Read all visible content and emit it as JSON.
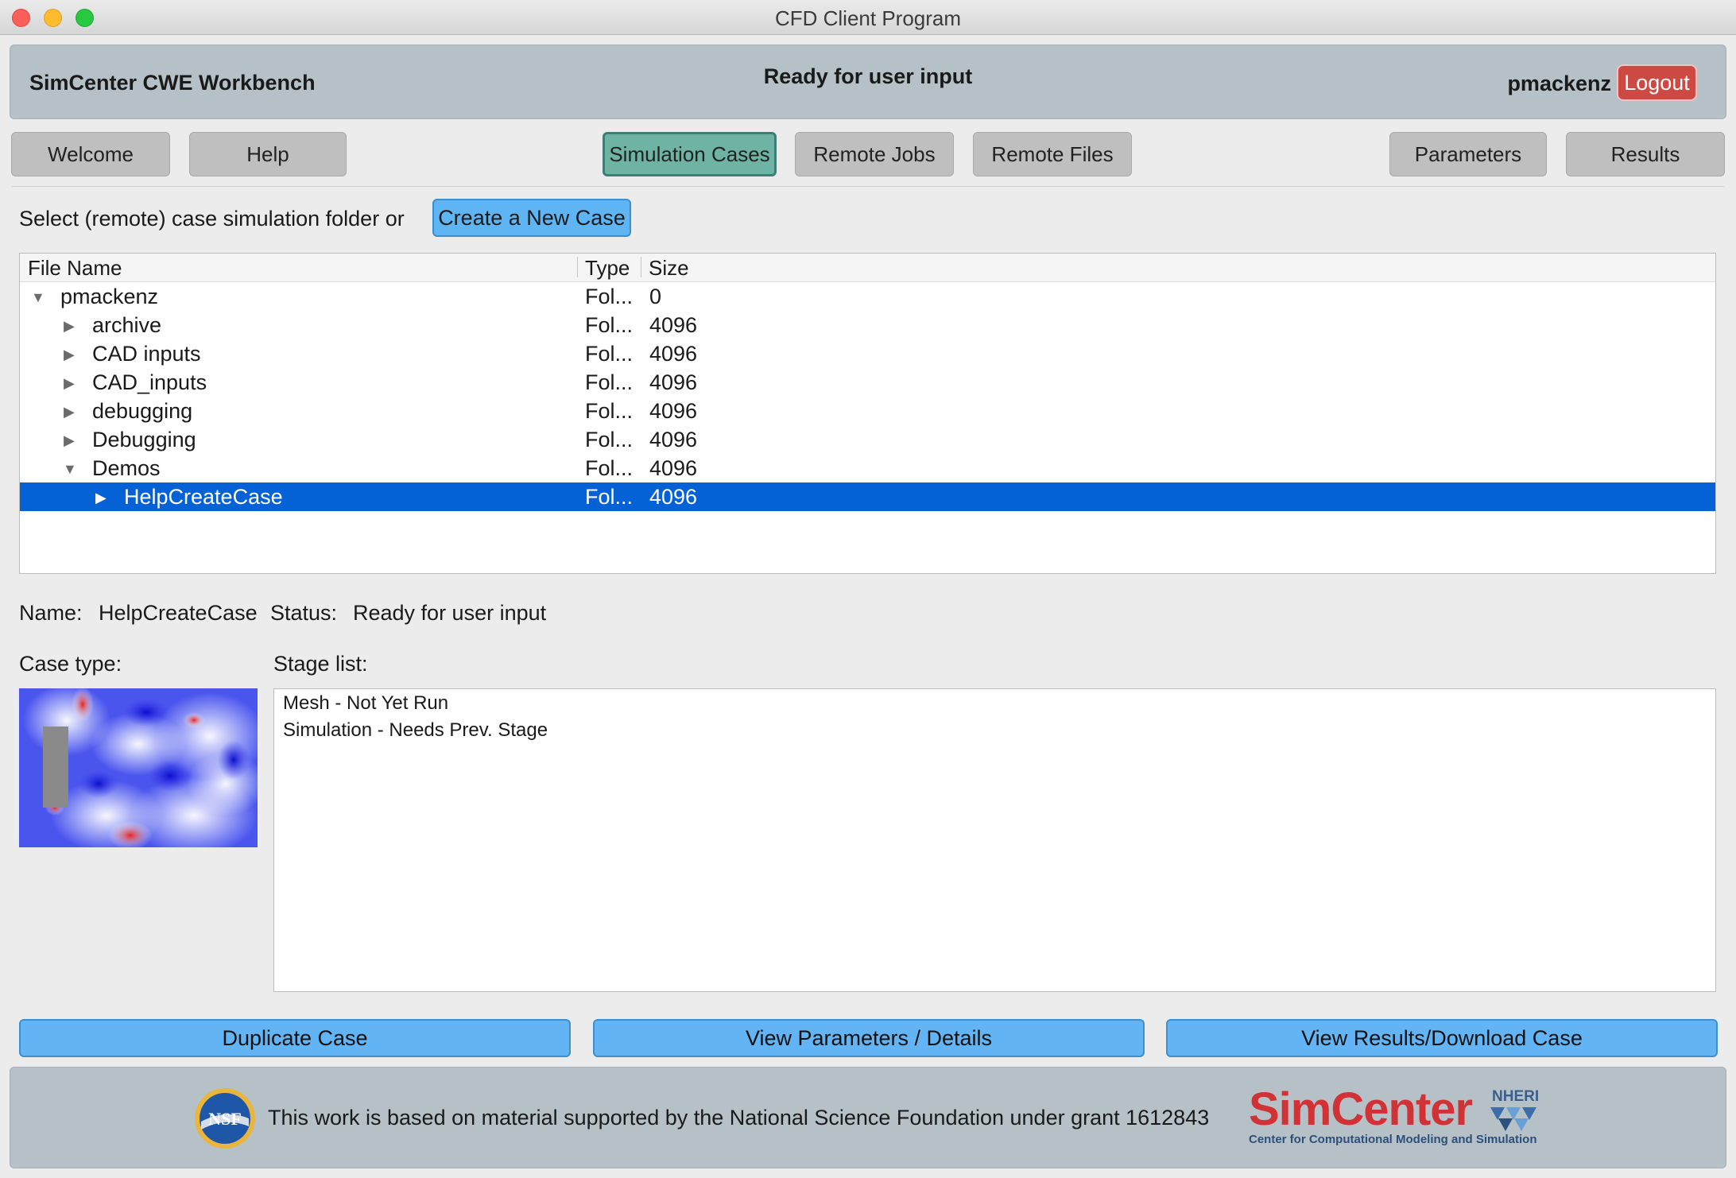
{
  "window": {
    "title": "CFD Client Program"
  },
  "header": {
    "app_title": "SimCenter CWE Workbench",
    "status": "Ready for user input",
    "username": "pmackenz",
    "logout_label": "Logout"
  },
  "tabs": [
    {
      "label": "Welcome",
      "active": false
    },
    {
      "label": "Help",
      "active": false
    },
    {
      "label": "Simulation Cases",
      "active": true
    },
    {
      "label": "Remote Jobs",
      "active": false
    },
    {
      "label": "Remote Files",
      "active": false
    },
    {
      "label": "Parameters",
      "active": false
    },
    {
      "label": "Results",
      "active": false
    }
  ],
  "select_prompt": "Select (remote) case simulation folder or",
  "create_button": "Create a New Case",
  "file_tree": {
    "columns": [
      "File Name",
      "Type",
      "Size"
    ],
    "rows": [
      {
        "name": "pmackenz",
        "type": "Fol...",
        "size": "0",
        "expanded": true
      },
      {
        "name": "archive",
        "type": "Fol...",
        "size": "4096",
        "expanded": false
      },
      {
        "name": "CAD inputs",
        "type": "Fol...",
        "size": "4096",
        "expanded": false
      },
      {
        "name": "CAD_inputs",
        "type": "Fol...",
        "size": "4096",
        "expanded": false
      },
      {
        "name": "debugging",
        "type": "Fol...",
        "size": "4096",
        "expanded": false
      },
      {
        "name": "Debugging",
        "type": "Fol...",
        "size": "4096",
        "expanded": false
      },
      {
        "name": "Demos",
        "type": "Fol...",
        "size": "4096",
        "expanded": true
      },
      {
        "name": "HelpCreateCase",
        "type": "Fol...",
        "size": "4096",
        "expanded": false,
        "selected": true
      }
    ]
  },
  "details": {
    "name_label": "Name:",
    "name_value": "HelpCreateCase",
    "status_label": "Status:",
    "status_value": "Ready for user input",
    "case_type_label": "Case type:",
    "stage_list_label": "Stage list:",
    "stages": [
      "Mesh - Not Yet Run",
      "Simulation - Needs Prev. Stage"
    ]
  },
  "actions": {
    "duplicate": "Duplicate Case",
    "view_params": "View Parameters / Details",
    "view_results": "View Results/Download Case"
  },
  "footer": {
    "logo_text": "NSF",
    "text": "This work is based on material supported by the National Science Foundation under grant 1612843",
    "brand": "SimCenter",
    "brand_tag": "NHERI",
    "brand_sub": "Center for Computational Modeling and Simulation"
  },
  "colors": {
    "header_bg": "#b5c1c6",
    "active_tab": "#6eb3a4",
    "accent_button": "#63b4f4",
    "logout": "#cd4a44",
    "selection": "#0561d6"
  }
}
